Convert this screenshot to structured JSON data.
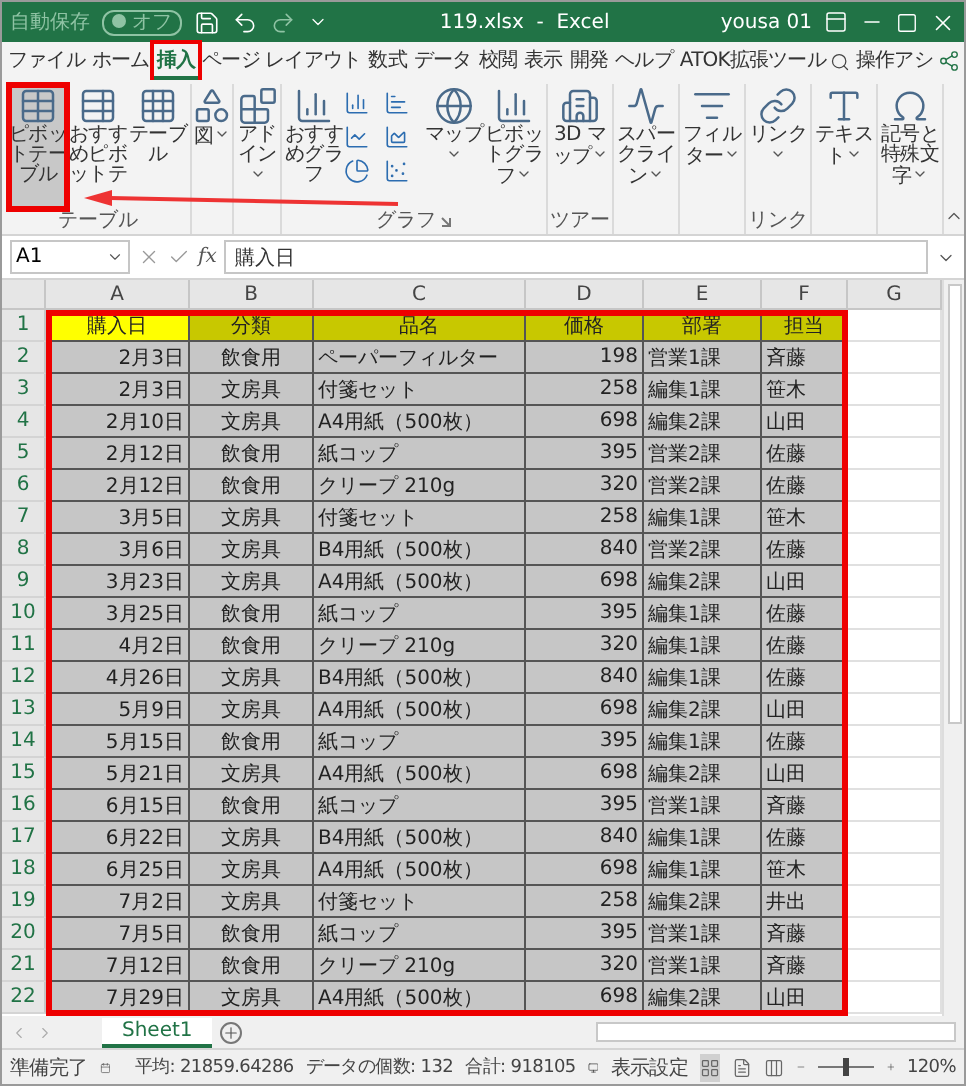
{
  "window": {
    "autosave_label": "自動保存",
    "autosave_state": "オフ",
    "autosave_on": false,
    "title": "119.xlsx  -  Excel",
    "user": "yousa 01"
  },
  "tabs": [
    {
      "label": "ファイル",
      "selected": false,
      "highlighted": false
    },
    {
      "label": "ホーム",
      "selected": false,
      "highlighted": false
    },
    {
      "label": "挿入",
      "selected": true,
      "highlighted": true
    },
    {
      "label": "ページ レイアウト",
      "selected": false,
      "highlighted": false
    },
    {
      "label": "数式",
      "selected": false,
      "highlighted": false
    },
    {
      "label": "データ",
      "selected": false,
      "highlighted": false
    },
    {
      "label": "校閲",
      "selected": false,
      "highlighted": false
    },
    {
      "label": "表示",
      "selected": false,
      "highlighted": false
    },
    {
      "label": "開発",
      "selected": false,
      "highlighted": false
    },
    {
      "label": "ヘルプ",
      "selected": false,
      "highlighted": false
    },
    {
      "label": "ATOK拡張ツール",
      "selected": false,
      "highlighted": false
    }
  ],
  "tell_me": "操作アシ",
  "ribbon": {
    "groups": [
      {
        "label": "テーブル",
        "items": [
          {
            "kind": "pivot",
            "label": "ピボットテーブル",
            "dropdown": false,
            "highlighted": true
          },
          {
            "kind": "pivotsuggest",
            "label": "おすすめピボットテ",
            "dropdown": false,
            "highlighted": false
          },
          {
            "kind": "table",
            "label": "テーブル",
            "dropdown": false,
            "highlighted": false
          }
        ]
      },
      {
        "items": [
          {
            "kind": "picture",
            "label": "図",
            "dropdown": true,
            "highlighted": false
          }
        ]
      },
      {
        "items": [
          {
            "kind": "addin",
            "label": "アドイン",
            "dropdown": true,
            "highlighted": false
          }
        ]
      },
      {
        "label": "グラフ",
        "launcher": true,
        "items": [
          {
            "kind": "chartsuggest",
            "label": "おすすめグラフ",
            "dropdown": false,
            "highlighted": false
          },
          {
            "kind": "gallery"
          },
          {
            "kind": "map",
            "label": "マップ",
            "dropdown": true,
            "highlighted": false
          },
          {
            "kind": "pivotchart",
            "label": "ピボットグラフ",
            "dropdown": true,
            "highlighted": false
          }
        ]
      },
      {
        "label": "ツアー",
        "items": [
          {
            "kind": "tour",
            "label": "3D マップ",
            "dropdown": true,
            "highlighted": false
          }
        ]
      },
      {
        "items": [
          {
            "kind": "sparkline",
            "label": "スパークライン",
            "dropdown": true,
            "highlighted": false
          }
        ]
      },
      {
        "items": [
          {
            "kind": "filter",
            "label": "フィルター",
            "dropdown": true,
            "highlighted": false
          }
        ]
      },
      {
        "label": "リンク",
        "items": [
          {
            "kind": "link",
            "label": "リンク",
            "dropdown": true,
            "highlighted": false
          }
        ]
      },
      {
        "items": [
          {
            "kind": "text",
            "label": "テキスト",
            "dropdown": true,
            "highlighted": false
          }
        ]
      },
      {
        "items": [
          {
            "kind": "symbol",
            "label": "記号と特殊文字",
            "dropdown": true,
            "highlighted": false
          }
        ]
      }
    ]
  },
  "formula_bar": {
    "name_box": "A1",
    "function_label": "fx",
    "value": "購入日"
  },
  "sheet": {
    "columns": [
      "A",
      "B",
      "C",
      "D",
      "E",
      "F",
      "G"
    ],
    "row_numbers": [
      "1",
      "2",
      "3",
      "4",
      "5",
      "6",
      "7",
      "8",
      "9",
      "10",
      "11",
      "12",
      "13",
      "14",
      "15",
      "16",
      "17",
      "18",
      "19",
      "20",
      "21",
      "22"
    ],
    "selected": true,
    "highlighted": true,
    "header": [
      {
        "text": "購入日",
        "active": true
      },
      {
        "text": "分類",
        "active": false
      },
      {
        "text": "品名",
        "active": false
      },
      {
        "text": "価格",
        "active": false
      },
      {
        "text": "部署",
        "active": false
      },
      {
        "text": "担当",
        "active": false
      }
    ],
    "rows": [
      [
        "2月3日",
        "飲食用",
        "ペーパーフィルター",
        "198",
        "営業1課",
        "斉藤"
      ],
      [
        "2月3日",
        "文房具",
        "付箋セット",
        "258",
        "編集1課",
        "笹木"
      ],
      [
        "2月10日",
        "文房具",
        "A4用紙（500枚）",
        "698",
        "編集2課",
        "山田"
      ],
      [
        "2月12日",
        "飲食用",
        "紙コップ",
        "395",
        "営業2課",
        "佐藤"
      ],
      [
        "2月12日",
        "飲食用",
        "クリープ 210g",
        "320",
        "営業2課",
        "佐藤"
      ],
      [
        "3月5日",
        "文房具",
        "付箋セット",
        "258",
        "編集1課",
        "笹木"
      ],
      [
        "3月6日",
        "文房具",
        "B4用紙（500枚）",
        "840",
        "営業2課",
        "佐藤"
      ],
      [
        "3月23日",
        "文房具",
        "A4用紙（500枚）",
        "698",
        "編集2課",
        "山田"
      ],
      [
        "3月25日",
        "飲食用",
        "紙コップ",
        "395",
        "編集1課",
        "佐藤"
      ],
      [
        "4月2日",
        "飲食用",
        "クリープ 210g",
        "320",
        "編集1課",
        "佐藤"
      ],
      [
        "4月26日",
        "文房具",
        "B4用紙（500枚）",
        "840",
        "編集1課",
        "佐藤"
      ],
      [
        "5月9日",
        "文房具",
        "A4用紙（500枚）",
        "698",
        "編集2課",
        "山田"
      ],
      [
        "5月15日",
        "飲食用",
        "紙コップ",
        "395",
        "編集1課",
        "佐藤"
      ],
      [
        "5月21日",
        "文房具",
        "A4用紙（500枚）",
        "698",
        "編集2課",
        "山田"
      ],
      [
        "6月15日",
        "飲食用",
        "紙コップ",
        "395",
        "営業1課",
        "斉藤"
      ],
      [
        "6月22日",
        "文房具",
        "B4用紙（500枚）",
        "840",
        "編集1課",
        "佐藤"
      ],
      [
        "6月25日",
        "文房具",
        "A4用紙（500枚）",
        "698",
        "編集1課",
        "笹木"
      ],
      [
        "7月2日",
        "文房具",
        "付箋セット",
        "258",
        "編集2課",
        "井出"
      ],
      [
        "7月5日",
        "飲食用",
        "紙コップ",
        "395",
        "営業1課",
        "斉藤"
      ],
      [
        "7月12日",
        "飲食用",
        "クリープ 210g",
        "320",
        "営業1課",
        "斉藤"
      ],
      [
        "7月29日",
        "文房具",
        "A4用紙（500枚）",
        "698",
        "編集2課",
        "山田"
      ]
    ]
  },
  "sheet_tabs": [
    {
      "label": "Sheet1",
      "selected": true
    }
  ],
  "status_bar": {
    "ready": "準備完了",
    "average": "平均: 21859.64286",
    "count": "データの個数: 132",
    "sum": "合計: 918105",
    "display_settings": "表示設定",
    "views": [
      {
        "kind": "normal",
        "selected": true
      },
      {
        "kind": "pagelayout",
        "selected": false
      },
      {
        "kind": "pagebreak",
        "selected": false
      }
    ],
    "zoom": {
      "level": 0.5,
      "reading": "120%"
    }
  }
}
